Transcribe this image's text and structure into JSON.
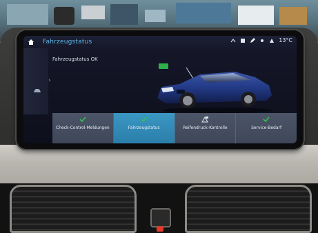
{
  "screen": {
    "title": "Fahrzeugstatus",
    "subtitle": "Fahrzeugstatus OK",
    "status": {
      "temperature": "13°C"
    },
    "tiles": [
      {
        "label": "Check-Control-Meldungen",
        "icon": "check-icon",
        "active": false
      },
      {
        "label": "Fahrzeugstatus",
        "icon": "check-icon",
        "active": true
      },
      {
        "label": "Reifendruck-Kontrolle",
        "icon": "tire-warning-icon",
        "active": false
      },
      {
        "label": "Service-Bedarf",
        "icon": "check-icon",
        "active": false
      }
    ],
    "badge_color": "#2db24a",
    "accent_color": "#5fb7e8",
    "active_tile_color": "#3a97c2"
  }
}
